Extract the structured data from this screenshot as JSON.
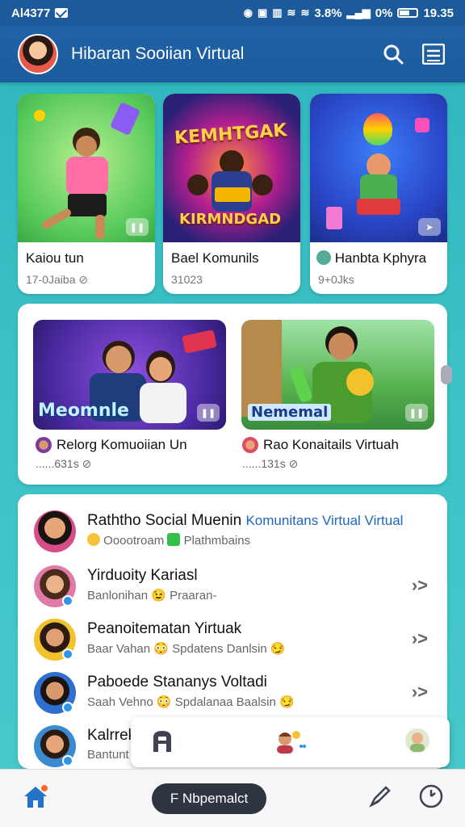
{
  "status_bar": {
    "time": "Al4377",
    "indicators": "3.8%",
    "signal": "0%",
    "clock": "19.35"
  },
  "app_bar": {
    "title": "Hibaran Sooiian Virtual",
    "icons": [
      "search-icon",
      "menu-icon"
    ]
  },
  "top_cards": [
    {
      "title": "Kaiou tun",
      "meta": "17-0Jaiba",
      "thumb_text": ""
    },
    {
      "title": "Bael Komunils",
      "meta": "31023",
      "thumb_text": "KEMHTGAK",
      "thumb_text2": "KIRMNDGAD"
    },
    {
      "title": "Hanbta Kphyra",
      "meta": "9+0Jks",
      "thumb_text": ""
    }
  ],
  "middle_cards": [
    {
      "title": "Relorg Komuoiian Un",
      "meta": "......631s",
      "banner": "Meomnle"
    },
    {
      "title": "Rao Konaitails Virtuah",
      "meta": "......131s",
      "banner": "Nememal"
    }
  ],
  "list": {
    "header": {
      "title": "Raththo Social Muenin",
      "link": "Komunitans Virtual Virtual",
      "sub_a": "Ooootroam",
      "sub_b": "Plathmbains"
    },
    "rows": [
      {
        "title": "Yirduoity Kariasl",
        "sub": "Banlonihan 😉 Praaran-"
      },
      {
        "title": "Peanoitematan Yirtuak",
        "sub": "Baar Vahan 😳 Spdatens Danlsin 😏"
      },
      {
        "title": "Paboede Stananys Voltadi",
        "sub": "Saah Vehno 😳 Spdalanaa Baalsin 😏"
      },
      {
        "title": "Kalrrek",
        "sub": "Bantunt"
      }
    ]
  },
  "tray": {
    "icons": [
      "a-logo-icon",
      "avatar-sparkle-icon",
      "avatar-icon"
    ]
  },
  "bottom_nav": {
    "compose_label": "F Nbpemalct",
    "icons": [
      "home-icon",
      "edit-icon",
      "clock-icon"
    ]
  },
  "colors": {
    "primary": "#1d5a9c",
    "background": "#3cc3c7",
    "link": "#1d66c2"
  }
}
